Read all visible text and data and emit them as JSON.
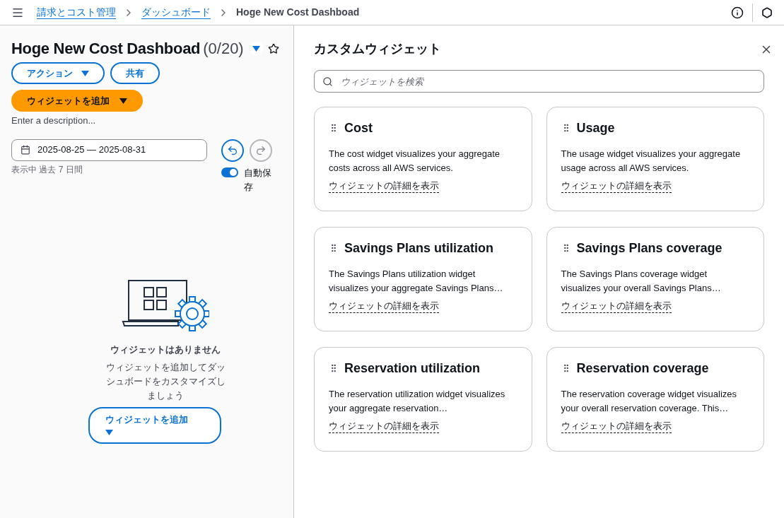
{
  "breadcrumbs": [
    {
      "label": "請求とコスト管理",
      "link": true
    },
    {
      "label": "ダッシュボード",
      "link": true
    },
    {
      "label": "Hoge New Cost Dashboad",
      "link": false
    }
  ],
  "dashboard": {
    "title": "Hoge New Cost Dashboad",
    "count": "(0/20)",
    "favorite": false,
    "buttons": [
      {
        "label": "アクション",
        "dropdown": true
      },
      {
        "label": "共有",
        "dropdown": false
      }
    ],
    "add_button": "ウィジェットを追加",
    "description_placeholder": "Enter a description...",
    "date_range": "2025-08-25 — 2025-08-31",
    "date_hint": "表示中 過去 7 日間",
    "undo_disabled": false,
    "redo_disabled": true,
    "autosave": {
      "label": "自動保存",
      "on": true
    }
  },
  "empty_state": {
    "title": "ウィジェットはありません",
    "text": "ウィジェットを追加してダッシュボードをカスタマイズしましょう",
    "button": "ウィジェットを追加"
  },
  "panel": {
    "title": "カスタムウィジェット",
    "search_placeholder": "ウィジェットを検索",
    "widgets": [
      {
        "title": "Cost",
        "description": "The cost widget visualizes your aggregate costs across all AWS services.",
        "link": "ウィジェットの詳細を表示"
      },
      {
        "title": "Usage",
        "description": "The usage widget visualizes your aggregate usage across all AWS services.",
        "link": "ウィジェットの詳細を表示"
      },
      {
        "title": "Savings Plans utilization",
        "description": "The Savings Plans utilization widget visualizes your aggregate Savings Plans…",
        "link": "ウィジェットの詳細を表示"
      },
      {
        "title": "Savings Plans coverage",
        "description": "The Savings Plans coverage widget visualizes your overall Savings Plans…",
        "link": "ウィジェットの詳細を表示"
      },
      {
        "title": "Reservation utilization",
        "description": "The reservation utilization widget visualizes your aggregate reservation…",
        "link": "ウィジェットの詳細を表示"
      },
      {
        "title": "Reservation coverage",
        "description": "The reservation coverage widget visualizes your overall reservation coverage. This…",
        "link": "ウィジェットの詳細を表示"
      }
    ]
  }
}
